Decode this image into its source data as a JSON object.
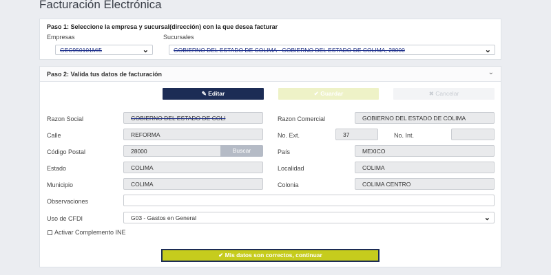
{
  "page": {
    "title": "Facturación Electrónica"
  },
  "step1": {
    "title": "Paso 1: Seleccione la empresa y sucursal(dirección) con la que desea facturar",
    "empresas_label": "Empresas",
    "empresas_value": "GEC950101MI5",
    "sucursales_label": "Sucursales",
    "sucursales_value": "GOBIERNO DEL ESTADO DE COLIMA - GOBIERNO DEL ESTADO DE COLIMA, 28000"
  },
  "step2": {
    "title": "Paso 2: Valida tus datos de facturación",
    "edit_label": "Editar",
    "save_label": "Guardar",
    "cancel_label": "Cancelar",
    "fields": {
      "razon_social": {
        "label": "Razon Social",
        "value": "GOBIERNO DEL ESTADO DE COLI"
      },
      "razon_comercial": {
        "label": "Razon Comercial",
        "value": "GOBIERNO DEL ESTADO DE COLIMA"
      },
      "calle": {
        "label": "Calle",
        "value": "REFORMA"
      },
      "no_ext": {
        "label": "No. Ext.",
        "value": "37"
      },
      "no_int": {
        "label": "No. Int.",
        "value": ""
      },
      "codigo_postal": {
        "label": "Código Postal",
        "value": "28000"
      },
      "pais": {
        "label": "País",
        "value": "MEXICO"
      },
      "estado": {
        "label": "Estado",
        "value": "COLIMA"
      },
      "localidad": {
        "label": "Localidad",
        "value": "COLIMA"
      },
      "municipio": {
        "label": "Municipio",
        "value": "COLIMA"
      },
      "colonia": {
        "label": "Colonia",
        "value": "COLIMA CENTRO"
      },
      "observaciones": {
        "label": "Observaciones",
        "value": ""
      },
      "uso_cfdi": {
        "label": "Uso de CFDI",
        "value": "G03 - Gastos en General"
      }
    },
    "buscar_label": "Buscar",
    "ine_label": "Activar Complemento INE",
    "continue_label": "Mis datos son correctos, continuar"
  },
  "icons": {
    "chevron": "⌄",
    "pencil": "✎",
    "check": "✔",
    "cross": "✖"
  }
}
